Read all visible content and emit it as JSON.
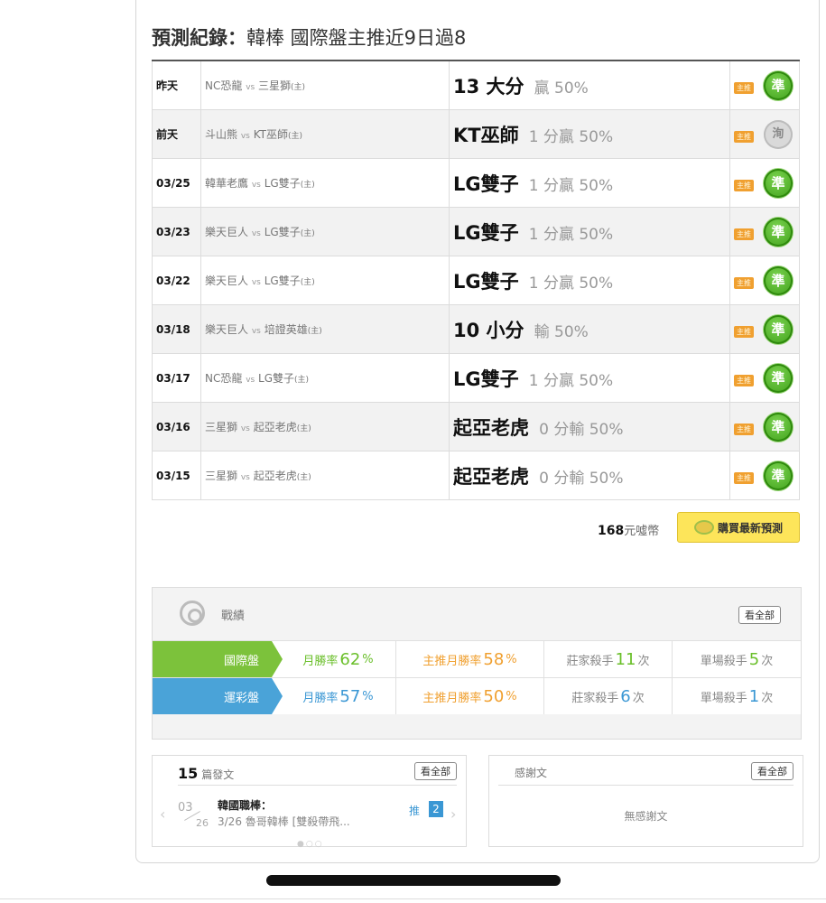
{
  "header": {
    "label": "預測紀錄：",
    "text": "韓棒 國際盤主推近9日過8"
  },
  "records": [
    {
      "date": "昨天",
      "away": "NC恐龍",
      "home": "三星獅",
      "pick": "13 大分",
      "result_text": "贏 50%",
      "tag": "主推",
      "badge": "準",
      "status": "win"
    },
    {
      "date": "前天",
      "away": "斗山熊",
      "home": "KT巫師",
      "pick": "KT巫師",
      "result_text": "1 分贏 50%",
      "tag": "主推",
      "badge": "洵",
      "status": "push"
    },
    {
      "date": "03/25",
      "away": "韓華老鷹",
      "home": "LG雙子",
      "pick": "LG雙子",
      "result_text": "1 分贏 50%",
      "tag": "主推",
      "badge": "準",
      "status": "win"
    },
    {
      "date": "03/23",
      "away": "樂天巨人",
      "home": "LG雙子",
      "pick": "LG雙子",
      "result_text": "1 分贏 50%",
      "tag": "主推",
      "badge": "準",
      "status": "win"
    },
    {
      "date": "03/22",
      "away": "樂天巨人",
      "home": "LG雙子",
      "pick": "LG雙子",
      "result_text": "1 分贏 50%",
      "tag": "主推",
      "badge": "準",
      "status": "win"
    },
    {
      "date": "03/18",
      "away": "樂天巨人",
      "home": "培證英雄",
      "pick": "10 小分",
      "result_text": "輸 50%",
      "tag": "主推",
      "badge": "準",
      "status": "win"
    },
    {
      "date": "03/17",
      "away": "NC恐龍",
      "home": "LG雙子",
      "pick": "LG雙子",
      "result_text": "1 分贏 50%",
      "tag": "主推",
      "badge": "準",
      "status": "win"
    },
    {
      "date": "03/16",
      "away": "三星獅",
      "home": "起亞老虎",
      "pick": "起亞老虎",
      "result_text": "0 分輸 50%",
      "tag": "主推",
      "badge": "準",
      "status": "win"
    },
    {
      "date": "03/15",
      "away": "三星獅",
      "home": "起亞老虎",
      "pick": "起亞老虎",
      "result_text": "0 分輸 50%",
      "tag": "主推",
      "badge": "準",
      "status": "win"
    }
  ],
  "vs_label": "vs",
  "host_mark": "(主)",
  "purchase": {
    "price": "168",
    "unit": "元噓幣",
    "button": "購買最新預測"
  },
  "stats": {
    "title": "戰績",
    "see_all": "看全部",
    "rows": [
      {
        "type": "國際盤",
        "month_label": "月勝率",
        "month_val": "62",
        "main_label": "主推月勝率",
        "main_val": "58",
        "killer_label": "莊家殺手",
        "killer_val": "11",
        "single_label": "單場殺手",
        "single_val": "5",
        "pct": "%",
        "times": "次"
      },
      {
        "type": "運彩盤",
        "month_label": "月勝率",
        "month_val": "57",
        "main_label": "主推月勝率",
        "main_val": "50",
        "killer_label": "莊家殺手",
        "killer_val": "6",
        "single_label": "單場殺手",
        "single_val": "1",
        "pct": "%",
        "times": "次"
      }
    ]
  },
  "posts": {
    "count": "15",
    "label": "篇發文",
    "see_all": "看全部",
    "month": "03",
    "day": "26",
    "title": "韓國職棒：",
    "subtitle": "3/26 魯哥韓棒 [雙殺帶飛...",
    "push_label": "推",
    "push_count": "2"
  },
  "thanks": {
    "title": "感謝文",
    "see_all": "看全部",
    "empty": "無感謝文"
  },
  "colors": {
    "win_green": "#4caf1f",
    "tag_orange": "#f0a030",
    "intl_green": "#7cc23b",
    "sports_blue": "#4aa3d8",
    "buy_yellow": "#fde55a"
  }
}
